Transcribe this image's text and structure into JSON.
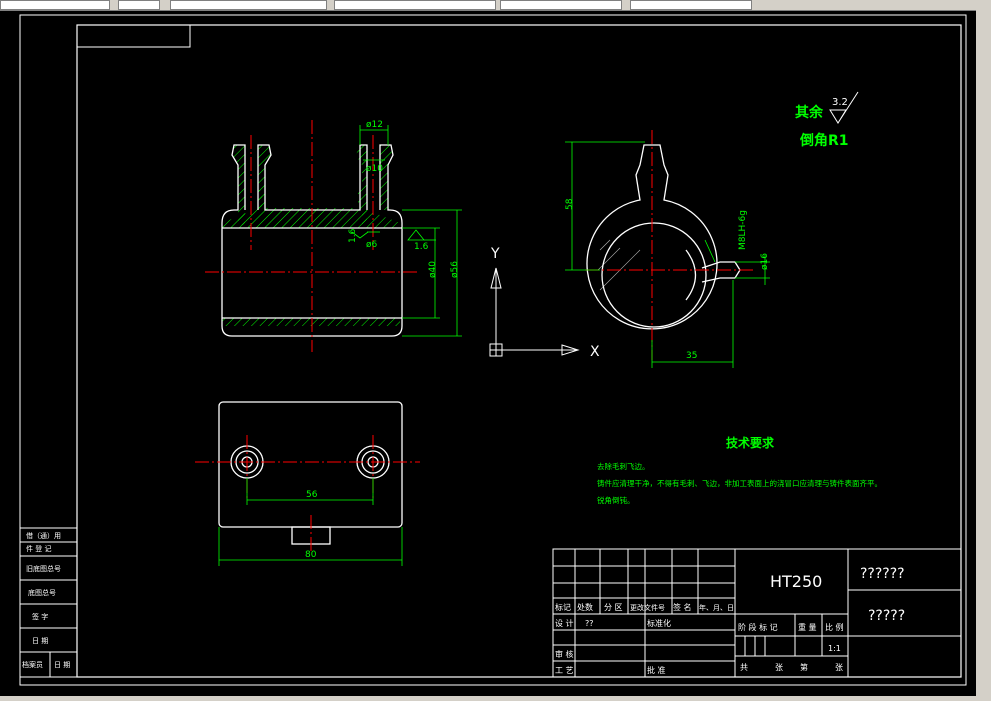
{
  "colors": {
    "background": "#000000",
    "outline": "#ffffff",
    "centerline": "#ff0000",
    "dimension": "#00ff00",
    "hatch": "#00ff00",
    "frame": "#ffffff"
  },
  "dimensions": {
    "d12": "ø12",
    "d10": "ø10",
    "d6": "ø6",
    "d40": "ø40",
    "d56": "ø56",
    "r16a": "1.6",
    "r16b": "1.6",
    "h58": "58",
    "w35": "35",
    "d16": "ø16",
    "thread": "M8LH-6g",
    "l56": "56",
    "l80": "80"
  },
  "ucs": {
    "y": "Y",
    "x": "X"
  },
  "roughness_note": {
    "rest": "其余",
    "value": "3.2",
    "chamfer": "倒角R1"
  },
  "tech_requirements": {
    "title": "技术要求",
    "lines": [
      "去除毛刺飞边。",
      "铸件应清理干净，不得有毛刺、飞边，非加工表面上的浇冒口应清理与铸件表面齐平。",
      "锐角倒钝。"
    ]
  },
  "title_block": {
    "material": "HT250",
    "name": "??????",
    "drawing_no": "?????",
    "rev_headers": [
      "标记",
      "处数",
      "分 区",
      "更改文件号",
      "签 名",
      "年、月、日"
    ],
    "design": "设 计",
    "designer": "??",
    "standardize": "标准化",
    "review": "审 核",
    "process": "工 艺",
    "approve": "批 准",
    "stage_headers": [
      "阶 段 标 记",
      "重 量",
      "比 例"
    ],
    "scale": "1:1",
    "sheets": [
      "共",
      "张",
      "第",
      "张"
    ]
  },
  "side_block": [
    "借（通）用",
    "件 登 记",
    "旧底图总号",
    "底图总号",
    "签 字",
    "日 期",
    "档案员",
    "日 期"
  ]
}
